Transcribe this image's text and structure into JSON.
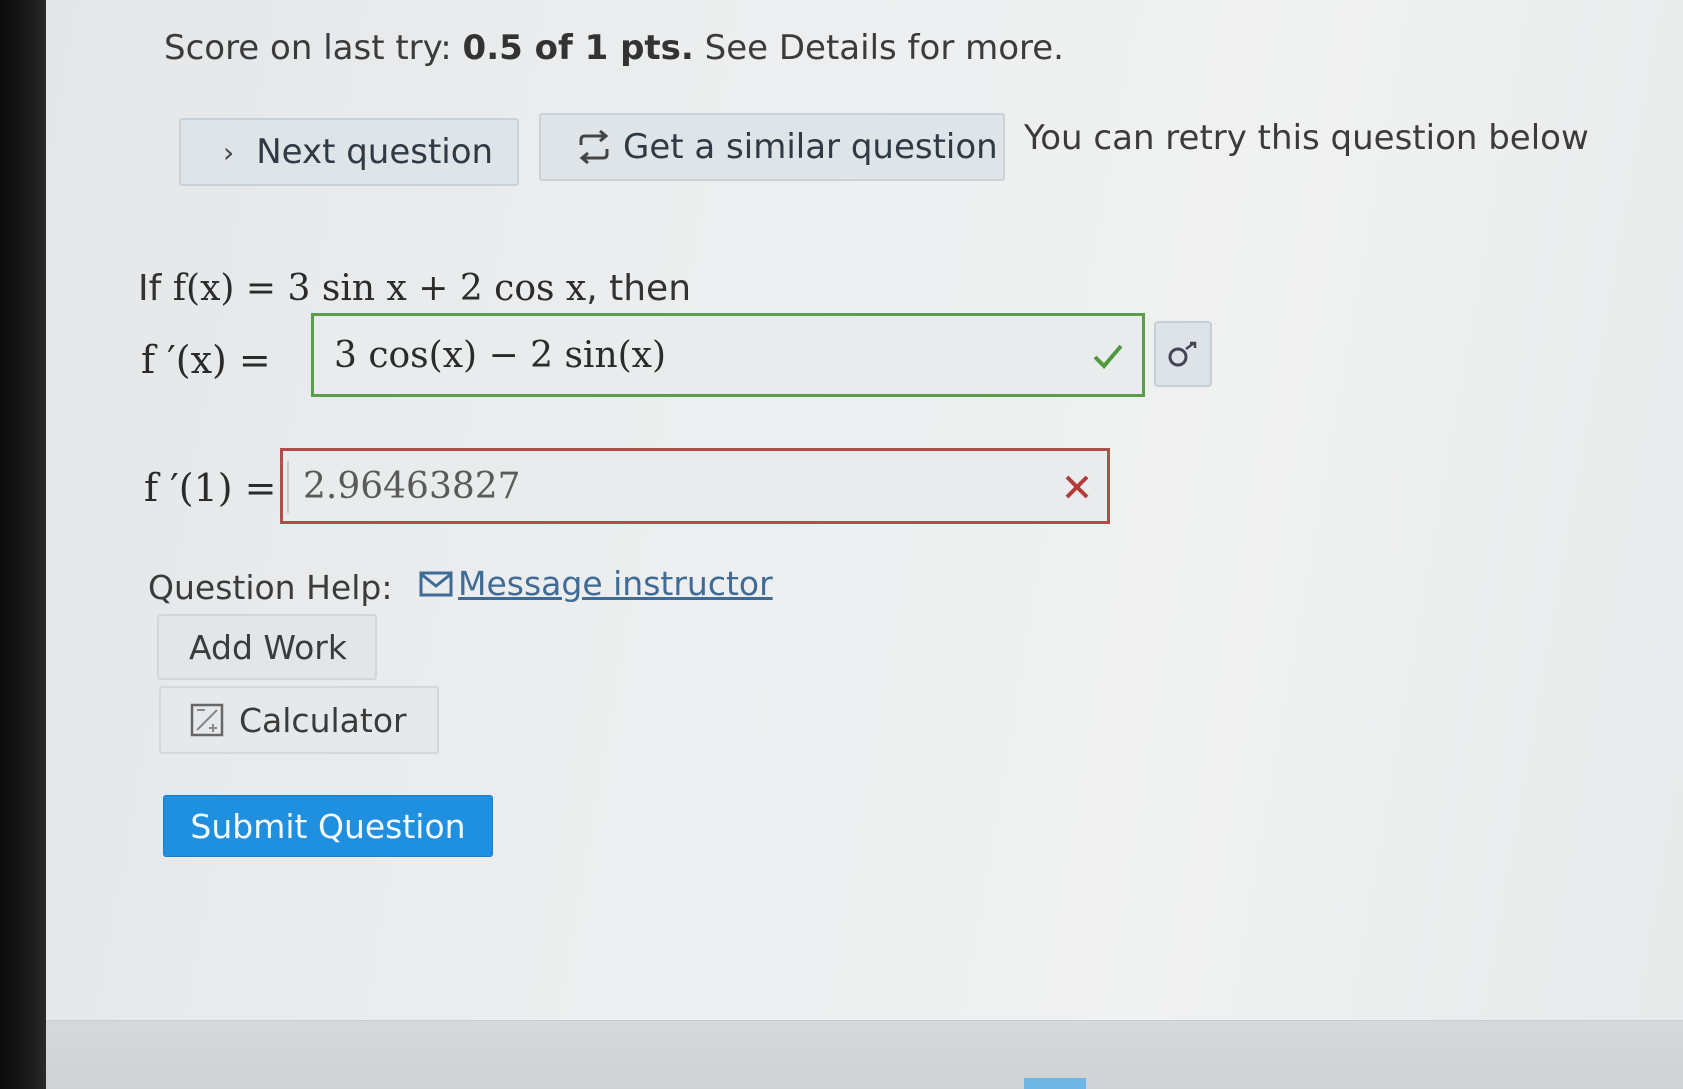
{
  "score": {
    "prefix": "Score on last try: ",
    "value": "0.5 of 1 pts.",
    "suffix": " See Details for more."
  },
  "actions": {
    "next_label": "Next question",
    "similar_label": "Get a similar question",
    "retry_text": "You can retry this question below"
  },
  "question": {
    "if_word": "If ",
    "function": "f(x) = 3 sin x + 2 cos x",
    "then_word": ", then",
    "derivative_label": "f ′(x) =",
    "derivative_answer": "3 cos(x) − 2 sin(x)",
    "derivative_status": "correct",
    "value_label": "f ′(1) =",
    "value_answer": "2.96463827",
    "value_status": "incorrect"
  },
  "help": {
    "label": "Question Help:",
    "message_link": "Message instructor"
  },
  "tools": {
    "add_work_label": "Add Work",
    "calculator_label": "Calculator"
  },
  "submit_label": "Submit Question",
  "colors": {
    "correct": "#5a9e4b",
    "incorrect": "#b64b4b",
    "primary": "#1f8fdf",
    "link": "#3f6b95"
  },
  "icons": {
    "next": "chevron-right-icon",
    "similar": "refresh-arrows-icon",
    "correct": "check-icon",
    "incorrect": "x-icon",
    "preview": "preview-icon",
    "message": "envelope-icon",
    "calculator": "calculator-icon"
  }
}
